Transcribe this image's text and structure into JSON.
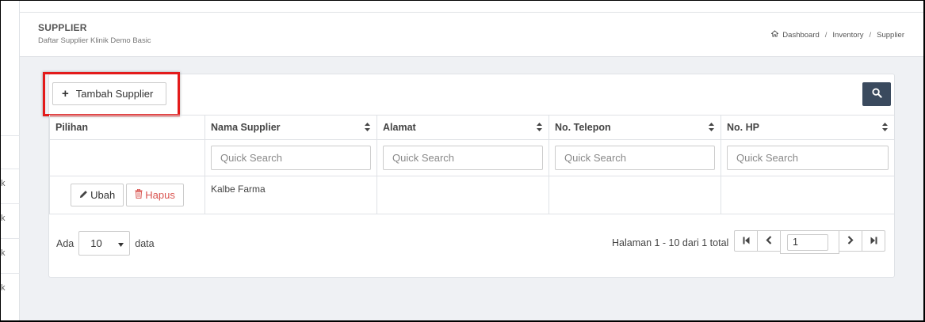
{
  "header": {
    "title": "SUPPLIER",
    "subtitle": "Daftar Supplier Klinik Demo Basic",
    "breadcrumb": [
      "Dashboard",
      "Inventory",
      "Supplier"
    ]
  },
  "toolbar": {
    "add_label": "Tambah Supplier",
    "highlight_color": "#e31b1b",
    "search_button_color": "#3a4a5e"
  },
  "table": {
    "columns": [
      "Pilihan",
      "Nama Supplier",
      "Alamat",
      "No. Telepon",
      "No. HP"
    ],
    "quick_search_placeholder": "Quick Search",
    "rows": [
      {
        "nama": "Kalbe Farma",
        "alamat": "",
        "telepon": "",
        "hp": ""
      }
    ],
    "edit_label": "Ubah",
    "delete_label": "Hapus",
    "delete_color": "#d9534f"
  },
  "footer": {
    "show_prefix": "Ada",
    "page_size": "10",
    "show_suffix": "data",
    "page_info": "Halaman 1 - 10 dari 1 total",
    "current_page": "1"
  },
  "sidebar": {
    "item_marks": [
      "k",
      "k",
      "k",
      "k"
    ]
  }
}
